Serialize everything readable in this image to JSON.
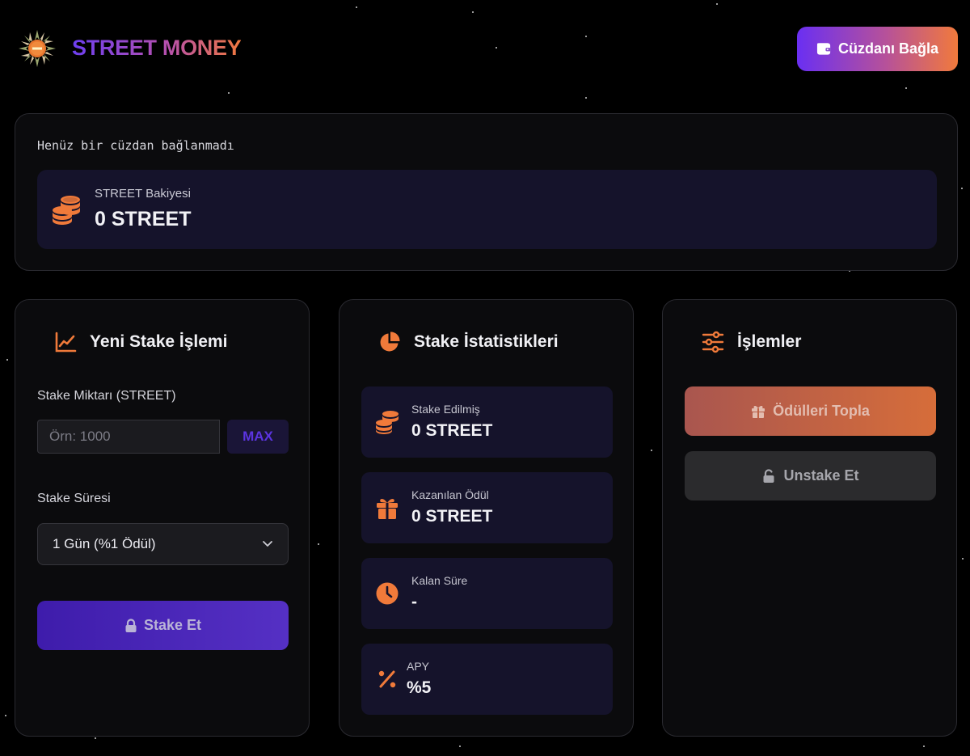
{
  "header": {
    "brand": "STREET MONEY",
    "logo_icon": "street-money-logo",
    "connect_button": "Cüzdanı Bağla",
    "connect_icon": "wallet-icon"
  },
  "wallet": {
    "status": "Henüz bir cüzdan bağlanmadı",
    "balance_label": "STREET Bakiyesi",
    "balance_value": "0 STREET",
    "balance_icon": "coins-icon"
  },
  "stake_form": {
    "title": "Yeni Stake İşlemi",
    "title_icon": "chart-line-icon",
    "amount_label": "Stake Miktarı (STREET)",
    "amount_placeholder": "Örn: 1000",
    "amount_value": "",
    "max_button": "MAX",
    "duration_label": "Stake Süresi",
    "duration_selected": "1 Gün (%1 Ödül)",
    "stake_button": "Stake Et",
    "stake_icon": "lock-icon"
  },
  "stats": {
    "title": "Stake İstatistikleri",
    "title_icon": "pie-chart-icon",
    "items": [
      {
        "label": "Stake Edilmiş",
        "value": "0 STREET",
        "icon": "coins-icon"
      },
      {
        "label": "Kazanılan Ödül",
        "value": "0 STREET",
        "icon": "gift-icon"
      },
      {
        "label": "Kalan Süre",
        "value": "-",
        "icon": "clock-icon"
      },
      {
        "label": "APY",
        "value": "%5",
        "icon": "percent-icon"
      }
    ]
  },
  "actions": {
    "title": "İşlemler",
    "title_icon": "sliders-icon",
    "collect_button": "Ödülleri Topla",
    "collect_icon": "gift-icon",
    "unstake_button": "Unstake Et",
    "unstake_icon": "unlock-icon"
  },
  "colors": {
    "accent_orange": "#f07a3a",
    "accent_purple": "#6a2ff2",
    "panel_bg": "#0b0b0d",
    "stat_bg": "#15132b"
  }
}
